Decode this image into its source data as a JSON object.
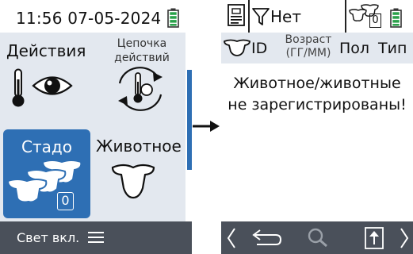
{
  "left_screen": {
    "status": {
      "clock": "11:56 07-05-2024",
      "battery_icon": "battery-full-icon"
    },
    "tiles": {
      "actions": {
        "label": "Действия",
        "icons": [
          "thermometer-icon",
          "eye-icon"
        ]
      },
      "action_chain": {
        "label_line1": "Цепочка",
        "label_line2": "действий",
        "icon": "cycle-thermometer-icon"
      },
      "herd": {
        "label": "Стадо",
        "count": "0",
        "icon": "herd-icon"
      },
      "animal": {
        "label": "Животное",
        "icon": "cow-head-icon"
      }
    },
    "footer": {
      "light_label": "Свет вкл.",
      "menu_icon": "menu-icon"
    }
  },
  "transition": {
    "arrow_icon": "arrow-right-icon"
  },
  "right_screen": {
    "status": {
      "filter_value": "Нет",
      "herd_count": "0"
    },
    "table": {
      "columns": {
        "id": "ID",
        "age_line1": "Возраст",
        "age_line2": "(ГГ/ММ)",
        "sex": "Пол",
        "type": "Тип"
      },
      "empty_message": "Животное/животные не зарегистрированы!"
    },
    "footer": {
      "icons": [
        "chevron-left-icon",
        "back-icon",
        "search-icon",
        "upload-icon",
        "chevron-right-icon"
      ]
    }
  },
  "colors": {
    "accent": "#2e6fb4",
    "battery": "#2aa14a",
    "footer": "#4a505a",
    "panel": "#e3e8ef"
  }
}
